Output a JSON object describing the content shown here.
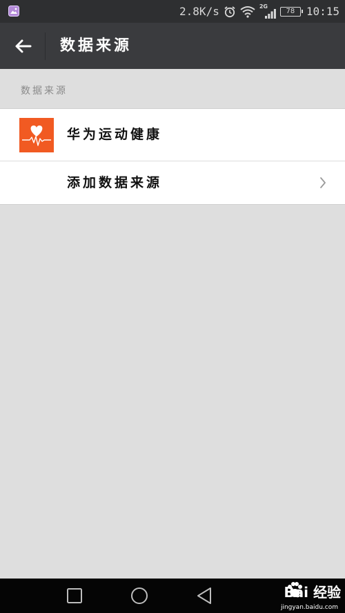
{
  "status_bar": {
    "speed": "2.8K/s",
    "network": "2G",
    "battery": "78",
    "time": "10:15",
    "icons": [
      "gallery-icon",
      "alarm-icon",
      "wifi-icon",
      "signal-icon",
      "battery-icon"
    ]
  },
  "header": {
    "title": "数据来源",
    "back_icon": "back-arrow-icon"
  },
  "section": {
    "title": "数据来源"
  },
  "list": {
    "items": [
      {
        "label": "华为运动健康",
        "icon": "huawei-health-logo"
      },
      {
        "label": "添加数据来源",
        "icon": "chevron-right-icon"
      }
    ]
  },
  "nav_bar": {
    "buttons": [
      "recent-apps-icon",
      "home-icon",
      "back-icon"
    ]
  },
  "watermark": {
    "text": "Bai 经验",
    "subtext": "jingyan.baidu.com"
  },
  "colors": {
    "status_bar_bg": "#2e2f31",
    "app_bar_bg": "#3a3b3e",
    "page_bg": "#dedede",
    "list_bg": "#ffffff",
    "logo_orange": "#f15a22",
    "nav_bar_bg": "#050505"
  }
}
